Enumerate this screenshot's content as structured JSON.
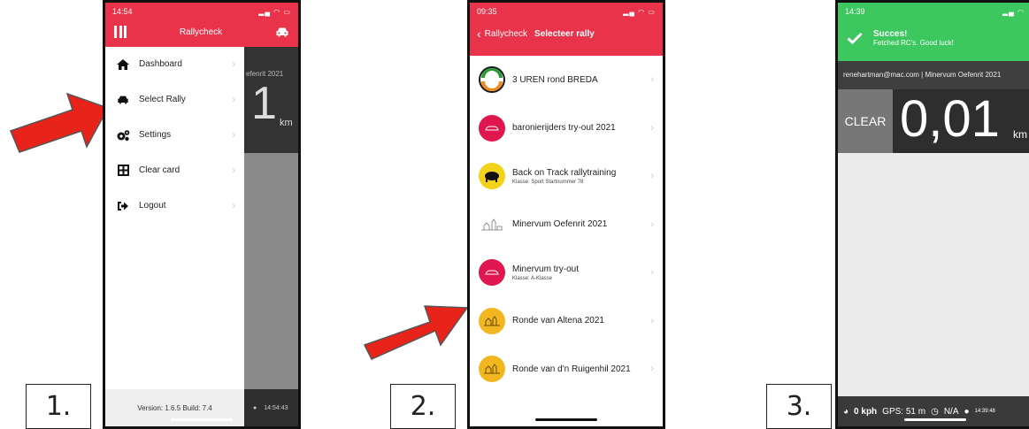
{
  "step_labels": [
    "1.",
    "2.",
    "3."
  ],
  "phone1": {
    "status_time": "14:54",
    "title": "Rallycheck",
    "menu": [
      {
        "label": "Dashboard",
        "icon": "home-icon"
      },
      {
        "label": "Select Rally",
        "icon": "car-icon"
      },
      {
        "label": "Settings",
        "icon": "cogs-icon"
      },
      {
        "label": "Clear card",
        "icon": "grid-icon"
      },
      {
        "label": "Logout",
        "icon": "logout-icon"
      }
    ],
    "bg_rally": "efenrit 2021",
    "bg_number": "1",
    "bg_unit": "km",
    "version": "Version: 1.6.5 Build: 7.4",
    "bg_time": "14:54:43"
  },
  "phone2": {
    "status_time": "09:35",
    "back_label": "Rallycheck",
    "title": "Selecteer rally",
    "rallies": [
      {
        "name": "3 UREN rond BREDA",
        "sub": ""
      },
      {
        "name": "baronierijders try-out 2021",
        "sub": ""
      },
      {
        "name": "Back on Track rallytraining",
        "sub": "Klasse: Sport Startnummer 78"
      },
      {
        "name": "Minervum Oefenrit 2021",
        "sub": ""
      },
      {
        "name": "Minervum try-out",
        "sub": "Klasse: A-Klasse"
      },
      {
        "name": "Ronde van Altena 2021",
        "sub": ""
      },
      {
        "name": "Ronde van d'n Ruigenhil 2021",
        "sub": ""
      }
    ]
  },
  "phone3": {
    "status_time": "14:39",
    "banner_title": "Succes!",
    "banner_msg": "Fetched RC's. Good luck!",
    "info": "renehartman@mac.com | Minervum Oefenrit 2021",
    "clear_label": "CLEAR",
    "distance": "0,01",
    "unit": "km",
    "speed": "0 kph",
    "gps": "GPS: 51 m",
    "na": "N/A",
    "time": "14:39:48"
  },
  "colors": {
    "brand_red": "#e8334a",
    "success_green": "#3cc85f",
    "arrow_red": "#e8231a"
  }
}
